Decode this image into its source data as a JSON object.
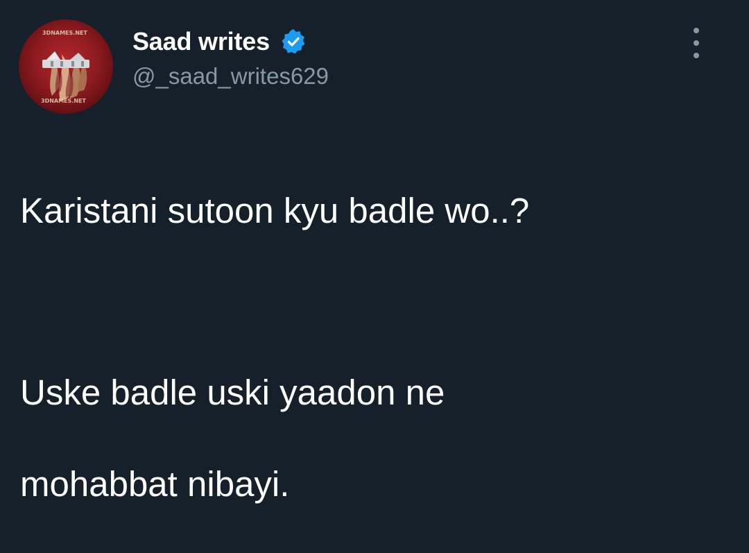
{
  "tweet": {
    "author": {
      "display_name": "Saad writes",
      "handle": "@_saad_writes629",
      "verified": true,
      "avatar": {
        "description_icon": "avatar-logo",
        "watermark_top": "3DNAMES.NET",
        "watermark_bottom": "3DNAMES.NET"
      }
    },
    "text": {
      "line1": "Karistani sutoon kyu badle wo..?",
      "line2": "Uske badle uski yaadon ne",
      "line3": "mohabbat nibayi."
    },
    "more_icon": "more-vertical-icon"
  },
  "theme": {
    "background": "#15202b",
    "text_primary": "#ffffff",
    "text_secondary": "#8899a6",
    "verified_badge": "#1d9bf0"
  }
}
